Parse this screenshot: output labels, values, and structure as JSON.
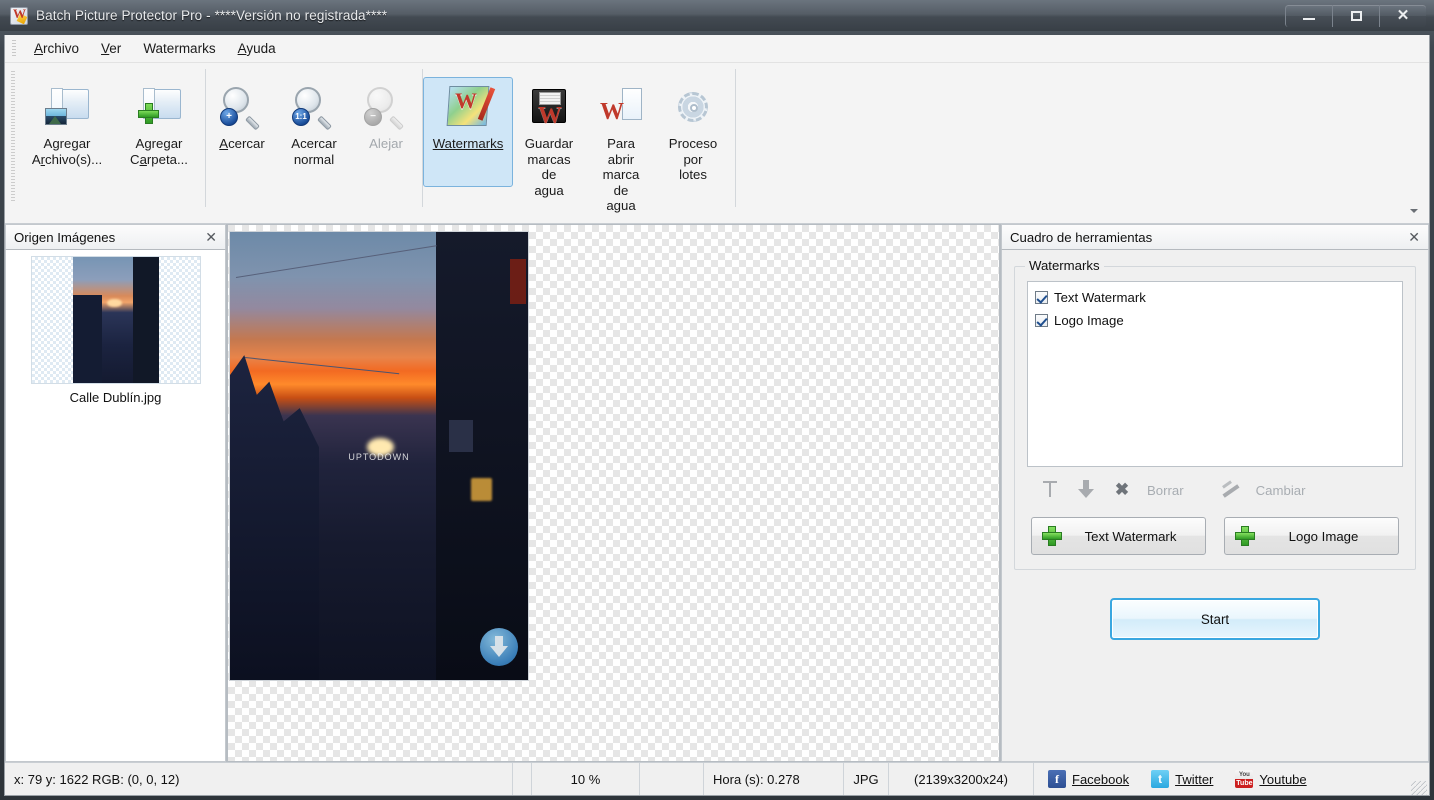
{
  "window": {
    "title": "Batch Picture Protector Pro - ****Versión no registrada****",
    "app_icon": "watermark-app-icon",
    "minimize": "–",
    "maximize": "❐",
    "close": "✕"
  },
  "menu": {
    "items": [
      {
        "label": "Archivo",
        "accel": "A"
      },
      {
        "label": "Ver",
        "accel": "V"
      },
      {
        "label": "Watermarks",
        "accel": ""
      },
      {
        "label": "Ayuda",
        "accel": "A"
      }
    ]
  },
  "toolbar": {
    "overflow_icon": "chevron-down-icon",
    "groups": [
      {
        "buttons": [
          {
            "label": "Agregar\nArchivo(s)...",
            "icon": "add-file-icon",
            "state": "enabled",
            "selected": false
          },
          {
            "label": "Agregar\nCarpeta...",
            "icon": "add-folder-icon",
            "state": "enabled",
            "selected": false
          }
        ]
      },
      {
        "buttons": [
          {
            "label": "Acercar",
            "icon": "zoom-in-icon",
            "state": "enabled",
            "selected": false
          },
          {
            "label": "Acercar\nnormal",
            "icon": "zoom-actual-icon",
            "state": "enabled",
            "selected": false
          },
          {
            "label": "Alejar",
            "icon": "zoom-out-icon",
            "state": "disabled",
            "selected": false
          }
        ]
      },
      {
        "buttons": [
          {
            "label": "Watermarks",
            "icon": "watermarks-icon",
            "state": "enabled",
            "selected": true
          },
          {
            "label": "Guardar\nmarcas\nde\nagua",
            "icon": "save-watermarks-icon",
            "state": "enabled",
            "selected": false
          },
          {
            "label": "Para\nabrir\nmarca\nde\nagua",
            "icon": "open-watermark-icon",
            "state": "enabled",
            "selected": false
          },
          {
            "label": "Proceso\npor\nlotes",
            "icon": "batch-process-icon",
            "state": "enabled",
            "selected": false
          }
        ]
      }
    ]
  },
  "left_dock": {
    "title": "Origen Imágenes",
    "close_icon": "close-icon",
    "files": [
      {
        "name": "Calle Dublín.jpg",
        "selected": true
      }
    ]
  },
  "canvas": {
    "image_watermark_text": "UPTODOWN",
    "logo_watermark": "download-arrow-logo"
  },
  "right_dock": {
    "title": "Cuadro de herramientas",
    "close_icon": "close-icon",
    "group_legend": "Watermarks",
    "watermark_list": [
      {
        "label": "Text Watermark",
        "checked": true
      },
      {
        "label": "Logo Image",
        "checked": true
      }
    ],
    "list_tools": [
      {
        "label": "",
        "icon": "move-up-icon",
        "state": "disabled"
      },
      {
        "label": "",
        "icon": "move-down-icon",
        "state": "disabled"
      },
      {
        "label": "",
        "icon": "delete-x-icon",
        "state": "disabled"
      },
      {
        "label": "Borrar",
        "icon": "",
        "state": "disabled"
      },
      {
        "label": "",
        "icon": "edit-pencil-icon",
        "state": "disabled"
      },
      {
        "label": "Cambiar",
        "icon": "",
        "state": "disabled"
      }
    ],
    "add_buttons": [
      {
        "label": "Text Watermark",
        "icon": "green-plus-icon"
      },
      {
        "label": "Logo Image",
        "icon": "green-plus-icon"
      }
    ],
    "start_button": "Start"
  },
  "statusbar": {
    "coords": "x: 79 y: 1622  RGB: (0, 0, 12)",
    "zoom": "10 %",
    "blank": "",
    "time": "Hora (s): 0.278",
    "format": "JPG",
    "dimensions": "(2139x3200x24)",
    "social": [
      {
        "label": "Facebook",
        "icon": "facebook-icon"
      },
      {
        "label": "Twitter",
        "icon": "twitter-icon"
      },
      {
        "label": "Youtube",
        "icon": "youtube-icon"
      }
    ]
  },
  "colors": {
    "accent": "#3aa7e0",
    "selection": "#cfe6f7",
    "green": "#2f9a24",
    "title_text": "#e8eaec"
  }
}
